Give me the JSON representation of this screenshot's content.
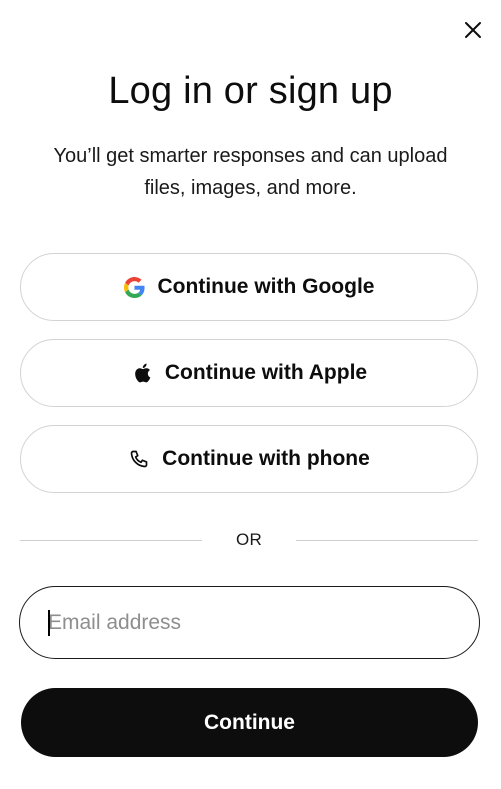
{
  "dialog": {
    "title": "Log in or sign up",
    "subtitle": "You’ll get smarter responses and can upload files, images, and more.",
    "close_icon": "close-icon"
  },
  "oauth": {
    "google_label": "Continue with Google",
    "apple_label": "Continue with Apple",
    "phone_label": "Continue with phone",
    "icons": [
      "google-icon",
      "apple-icon",
      "phone-icon"
    ]
  },
  "divider": {
    "label": "OR"
  },
  "email": {
    "value": "",
    "placeholder": "Email address"
  },
  "submit": {
    "label": "Continue"
  },
  "colors": {
    "primary": "#0d0d0d",
    "border": "#d3d3d3",
    "placeholder": "#8e8e8e",
    "google_blue": "#4285F4",
    "google_red": "#EA4335",
    "google_yellow": "#FBBC05",
    "google_green": "#34A853"
  }
}
